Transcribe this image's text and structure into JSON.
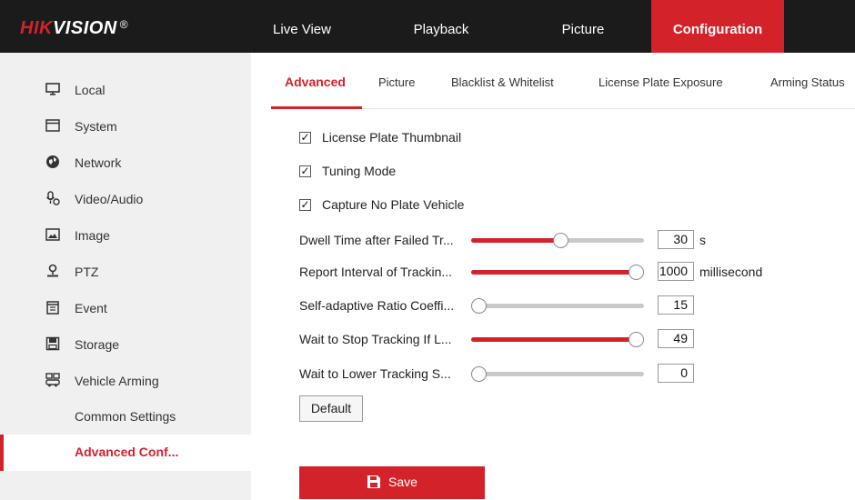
{
  "brand": {
    "name_red": "HIK",
    "name_rest": "VISION",
    "reg": "®"
  },
  "nav": [
    {
      "label": "Live View"
    },
    {
      "label": "Playback"
    },
    {
      "label": "Picture"
    },
    {
      "label": "Configuration"
    }
  ],
  "sidebar": {
    "items": [
      {
        "label": "Local",
        "icon": "monitor-icon"
      },
      {
        "label": "System",
        "icon": "window-icon"
      },
      {
        "label": "Network",
        "icon": "globe-icon"
      },
      {
        "label": "Video/Audio",
        "icon": "microphone-icon"
      },
      {
        "label": "Image",
        "icon": "image-icon"
      },
      {
        "label": "PTZ",
        "icon": "ptz-icon"
      },
      {
        "label": "Event",
        "icon": "calendar-icon"
      },
      {
        "label": "Storage",
        "icon": "storage-icon"
      },
      {
        "label": "Vehicle Arming",
        "icon": "vehicle-arming-icon"
      }
    ],
    "subitems": [
      {
        "label": "Common Settings"
      },
      {
        "label": "Advanced Conf..."
      }
    ]
  },
  "tabs": [
    {
      "label": "Advanced"
    },
    {
      "label": "Picture"
    },
    {
      "label": "Blacklist & Whitelist"
    },
    {
      "label": "License Plate Exposure"
    },
    {
      "label": "Arming Status"
    }
  ],
  "checkboxes": [
    {
      "label": "License Plate Thumbnail",
      "checked": true
    },
    {
      "label": "Tuning Mode",
      "checked": true
    },
    {
      "label": "Capture No Plate Vehicle",
      "checked": true
    }
  ],
  "sliders": [
    {
      "label": "Dwell Time after Failed Tr...",
      "value": "30",
      "unit": "s",
      "fraction": 0.52
    },
    {
      "label": "Report Interval of Trackin...",
      "value": "1000",
      "unit": "millisecond",
      "fraction": 1.0
    },
    {
      "label": "Self-adaptive Ratio Coeffi...",
      "value": "15",
      "unit": "",
      "fraction": 0.0
    },
    {
      "label": "Wait to Stop Tracking If L...",
      "value": "49",
      "unit": "",
      "fraction": 1.0
    },
    {
      "label": "Wait to Lower Tracking S...",
      "value": "0",
      "unit": "",
      "fraction": 0.0
    }
  ],
  "buttons": {
    "default_label": "Default",
    "save_label": "Save"
  },
  "colors": {
    "accent": "#d4222b",
    "topbar": "#1b1b1b",
    "sidebar": "#f0f0f0"
  }
}
